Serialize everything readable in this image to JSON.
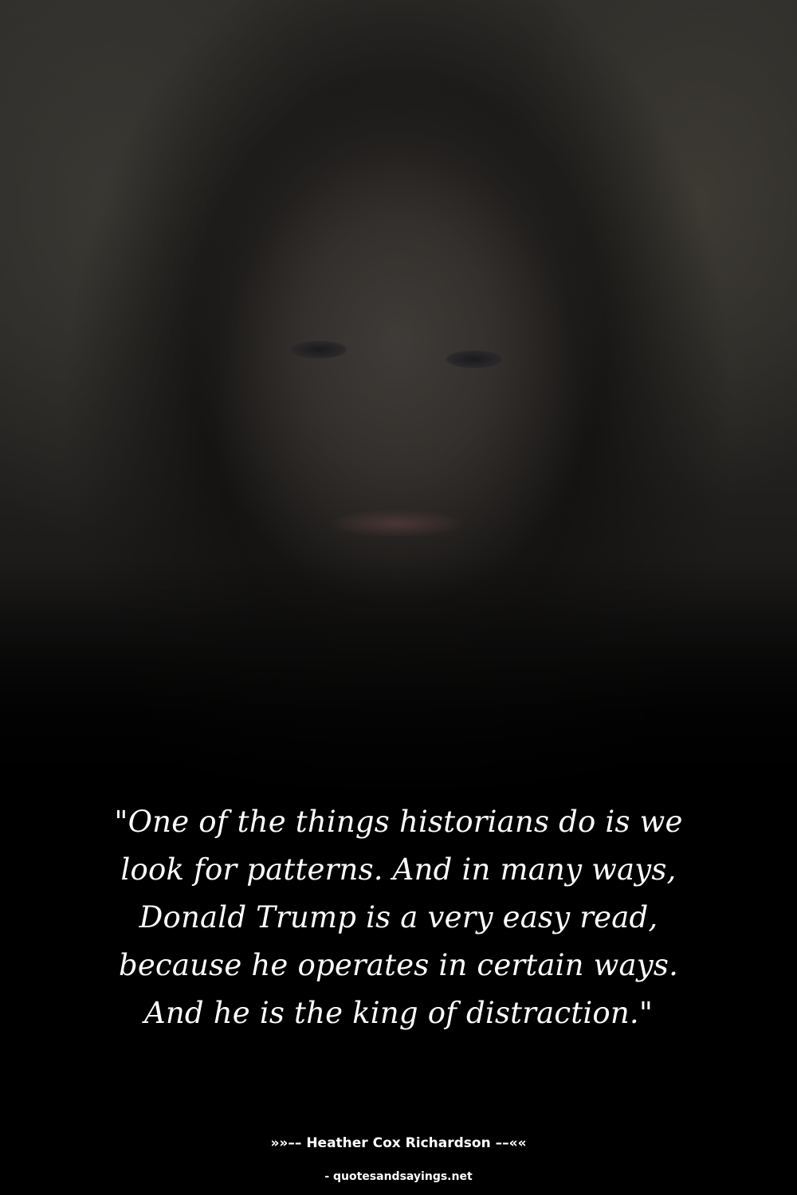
{
  "quote": {
    "text": "\"One of the things historians do is we look for patterns. And in many ways, Donald Trump is a very easy read, because he operates in certain ways. And he is the king of distraction.\""
  },
  "attribution": {
    "author_line": "»»–– Heather Cox Richardson ––««"
  },
  "footer": {
    "source": "- quotesandsayings.net"
  },
  "colors": {
    "background": "#000000",
    "text": "#ffffff"
  }
}
